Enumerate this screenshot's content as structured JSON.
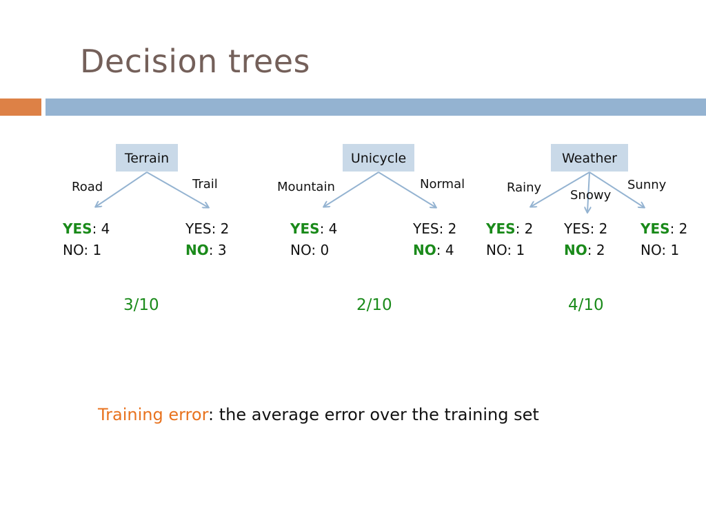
{
  "slide": {
    "title": "Decision trees",
    "accent_colors": {
      "orange": "#dd8146",
      "blue": "#94b3d1",
      "green": "#1a8a1a",
      "node_fill": "#c9d9e8"
    }
  },
  "trees": [
    {
      "feature": "Terrain",
      "branches": [
        {
          "label": "Road",
          "yes_label": "YES",
          "yes": "4",
          "no_label": "NO",
          "no": "1",
          "majority": "yes"
        },
        {
          "label": "Trail",
          "yes_label": "YES",
          "yes": "2",
          "no_label": "NO",
          "no": "3",
          "majority": "no"
        }
      ],
      "error": "3/10"
    },
    {
      "feature": "Unicycle",
      "branches": [
        {
          "label": "Mountain",
          "yes_label": "YES",
          "yes": "4",
          "no_label": "NO",
          "no": "0",
          "majority": "yes"
        },
        {
          "label": "Normal",
          "yes_label": "YES",
          "yes": "2",
          "no_label": "NO",
          "no": "4",
          "majority": "no"
        }
      ],
      "error": "2/10"
    },
    {
      "feature": "Weather",
      "branches": [
        {
          "label": "Rainy",
          "yes_label": "YES",
          "yes": "2",
          "no_label": "NO",
          "no": "1",
          "majority": "yes"
        },
        {
          "label": "Snowy",
          "yes_label": "YES",
          "yes": "2",
          "no_label": "NO",
          "no": "2",
          "majority": "no"
        },
        {
          "label": "Sunny",
          "yes_label": "YES",
          "yes": "2",
          "no_label": "NO",
          "no": "1",
          "majority": "yes"
        }
      ],
      "error": "4/10"
    }
  ],
  "footer": {
    "term": "Training error",
    "colon": ":",
    "definition": " the average error over the training set"
  }
}
